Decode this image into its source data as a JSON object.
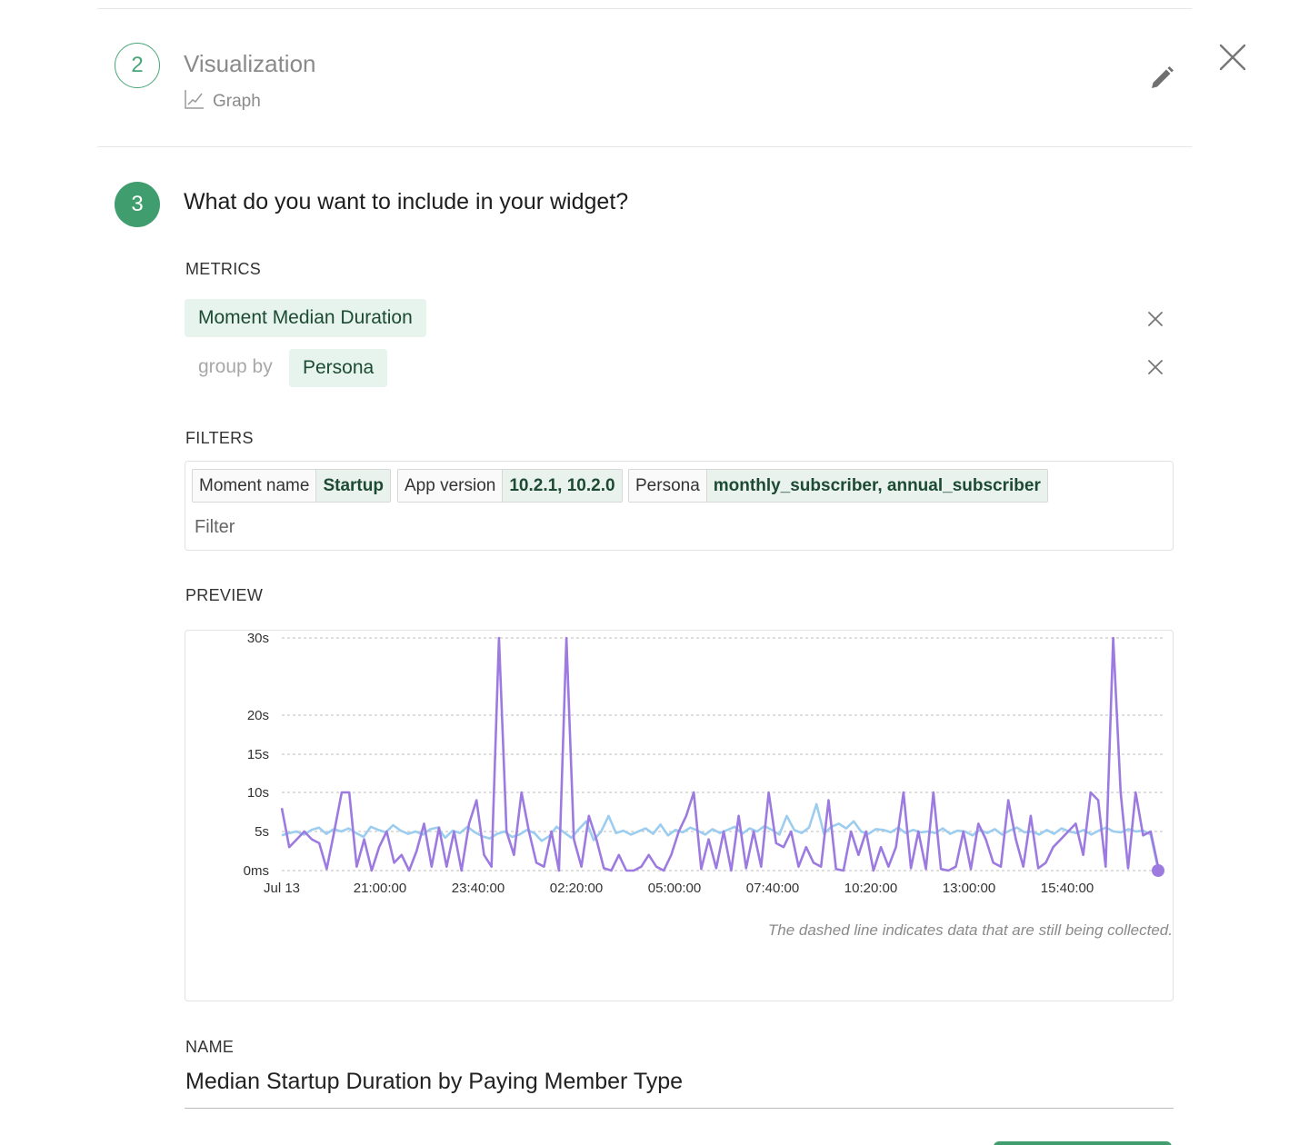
{
  "step2": {
    "number": "2",
    "title": "Visualization",
    "type_label": "Graph",
    "icon": "graph-icon"
  },
  "step3": {
    "number": "3",
    "question": "What do you want to include in your widget?"
  },
  "metrics": {
    "label": "METRICS",
    "metric": "Moment Median Duration",
    "group_by_label": "group by",
    "group_by_value": "Persona"
  },
  "filters": {
    "label": "FILTERS",
    "tags": [
      {
        "key": "Moment name",
        "value": "Startup"
      },
      {
        "key": "App version",
        "value": "10.2.1, 10.2.0"
      },
      {
        "key": "Persona",
        "value": "monthly_subscriber, annual_subscriber"
      }
    ],
    "placeholder": "Filter"
  },
  "preview": {
    "label": "PREVIEW",
    "note": "The dashed line indicates data that are still being collected."
  },
  "name_section": {
    "label": "NAME",
    "value": "Median Startup Duration by Paying Member Type"
  },
  "colors": {
    "accent": "#3f9d6e",
    "chip_bg": "#e6f4ed",
    "series_purple": "#9d7ae0",
    "series_blue": "#9ccdef"
  },
  "chart_data": {
    "type": "line",
    "yticks": [
      {
        "label": "30s",
        "value": 30
      },
      {
        "label": "20s",
        "value": 20
      },
      {
        "label": "15s",
        "value": 15
      },
      {
        "label": "10s",
        "value": 10
      },
      {
        "label": "5s",
        "value": 5
      },
      {
        "label": "0ms",
        "value": 0
      }
    ],
    "xticks": [
      "Jul 13",
      "21:00:00",
      "23:40:00",
      "02:20:00",
      "05:00:00",
      "07:40:00",
      "10:20:00",
      "13:00:00",
      "15:40:00"
    ],
    "ylim": [
      0,
      30
    ],
    "grid": true,
    "series": [
      {
        "color": "#9d7ae0",
        "values": [
          8,
          3,
          4,
          5,
          4,
          3.5,
          0.2,
          5,
          10,
          10,
          0.5,
          4,
          0,
          3,
          5,
          1,
          2,
          0,
          2.5,
          6,
          0.5,
          5.5,
          0.5,
          5,
          0,
          6,
          9,
          2,
          0.5,
          30,
          5,
          2,
          10,
          5,
          1,
          0.5,
          5,
          0,
          30,
          4,
          0.5,
          7,
          4,
          0.3,
          0,
          2,
          0,
          0,
          0.5,
          2,
          0.5,
          0,
          2,
          5,
          7,
          10,
          0.2,
          4,
          0.3,
          5,
          0,
          7,
          0.3,
          5,
          0.5,
          10,
          3.5,
          3,
          5,
          0.5,
          3,
          1,
          0.5,
          9,
          0.2,
          0,
          5,
          2,
          5,
          0,
          3,
          0.5,
          3,
          10,
          0.3,
          5,
          0.2,
          10,
          0.2,
          0,
          0.5,
          5,
          0.2,
          6,
          4,
          1,
          0.5,
          9,
          4,
          0.5,
          7,
          0.3,
          1,
          3,
          4,
          5,
          6,
          2,
          10,
          9,
          0.5,
          30,
          10,
          0.3,
          10,
          4.5,
          5,
          0.5
        ]
      },
      {
        "color": "#9ccdef",
        "values": [
          4.5,
          4.8,
          5,
          4.6,
          5.2,
          5.5,
          4.7,
          5.3,
          5.0,
          5.4,
          4.8,
          4.3,
          5.6,
          5.2,
          4.9,
          5.8,
          5.1,
          4.7,
          5.0,
          4.6,
          5.3,
          5.5,
          4.2,
          5.1,
          4.8,
          5.6,
          4.9,
          4.4,
          4.1,
          4.7,
          5.0,
          4.3,
          4.6,
          5.2,
          4.8,
          3.8,
          4.4,
          5.6,
          4.9,
          4.2,
          5.3,
          6.3,
          3.9,
          5.0,
          7.0,
          4.8,
          5.1,
          4.6,
          5.0,
          5.4,
          4.7,
          5.9,
          4.5,
          5.2,
          4.9,
          5.5,
          5.1,
          4.6,
          5.3,
          4.8,
          5.2,
          5.6,
          4.7,
          5.4,
          5.0,
          5.7,
          5.2,
          4.6,
          7.0,
          5.2,
          4.8,
          5.5,
          8.5,
          4.7,
          5.6,
          6.0,
          5.4,
          6.3,
          5.0,
          4.7,
          5.3,
          5.2,
          4.9,
          5.5,
          4.8,
          5.2,
          4.9,
          5.0,
          4.8,
          5.4,
          4.7,
          5.1,
          5.0,
          4.5,
          5.2,
          4.8,
          5.3,
          4.6,
          5.1,
          5.5,
          4.9,
          5.0,
          4.6,
          5.2,
          4.7,
          5.4,
          5.0,
          4.8,
          5.2,
          4.6,
          5.1,
          5.5,
          5.0,
          4.9,
          5.3,
          5.0,
          5.1,
          4.6,
          0.2
        ]
      }
    ],
    "last_point_marker": {
      "series": 0,
      "value": 0
    }
  }
}
